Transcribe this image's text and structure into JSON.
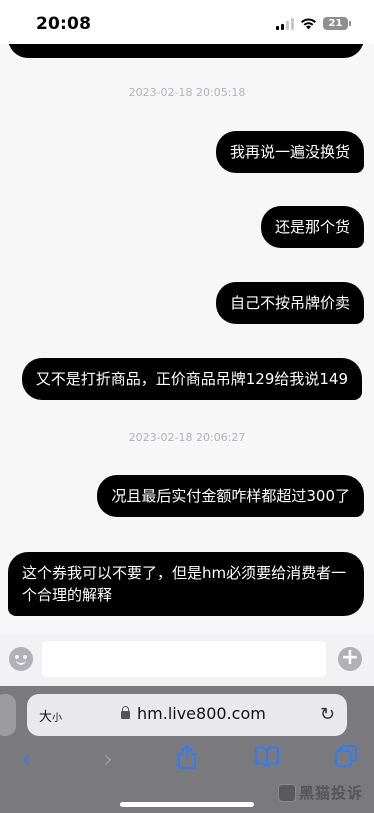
{
  "status_bar": {
    "time": "20:08",
    "battery": "21"
  },
  "chat": {
    "messages": [
      {
        "text": "我再说一遍没换货"
      },
      {
        "text": "还是那个货"
      },
      {
        "text": "自己不按吊牌价卖"
      },
      {
        "text": "又不是打折商品，正价商品吊牌129给我说149"
      },
      {
        "text": "况且最后实付金额咋样都超过300了"
      },
      {
        "text": "这个券我可以不要了，但是hm必须要给消费者一个合理的解释"
      }
    ],
    "timestamps": [
      "2023-02-18 20:05:18",
      "2023-02-18 20:06:27"
    ]
  },
  "input": {
    "value": ""
  },
  "browser": {
    "font_size_label": "大",
    "font_size_small": "小",
    "url": "hm.live800.com",
    "accent": "#2f7cf6"
  },
  "watermark": {
    "text": "黑猫投诉"
  }
}
